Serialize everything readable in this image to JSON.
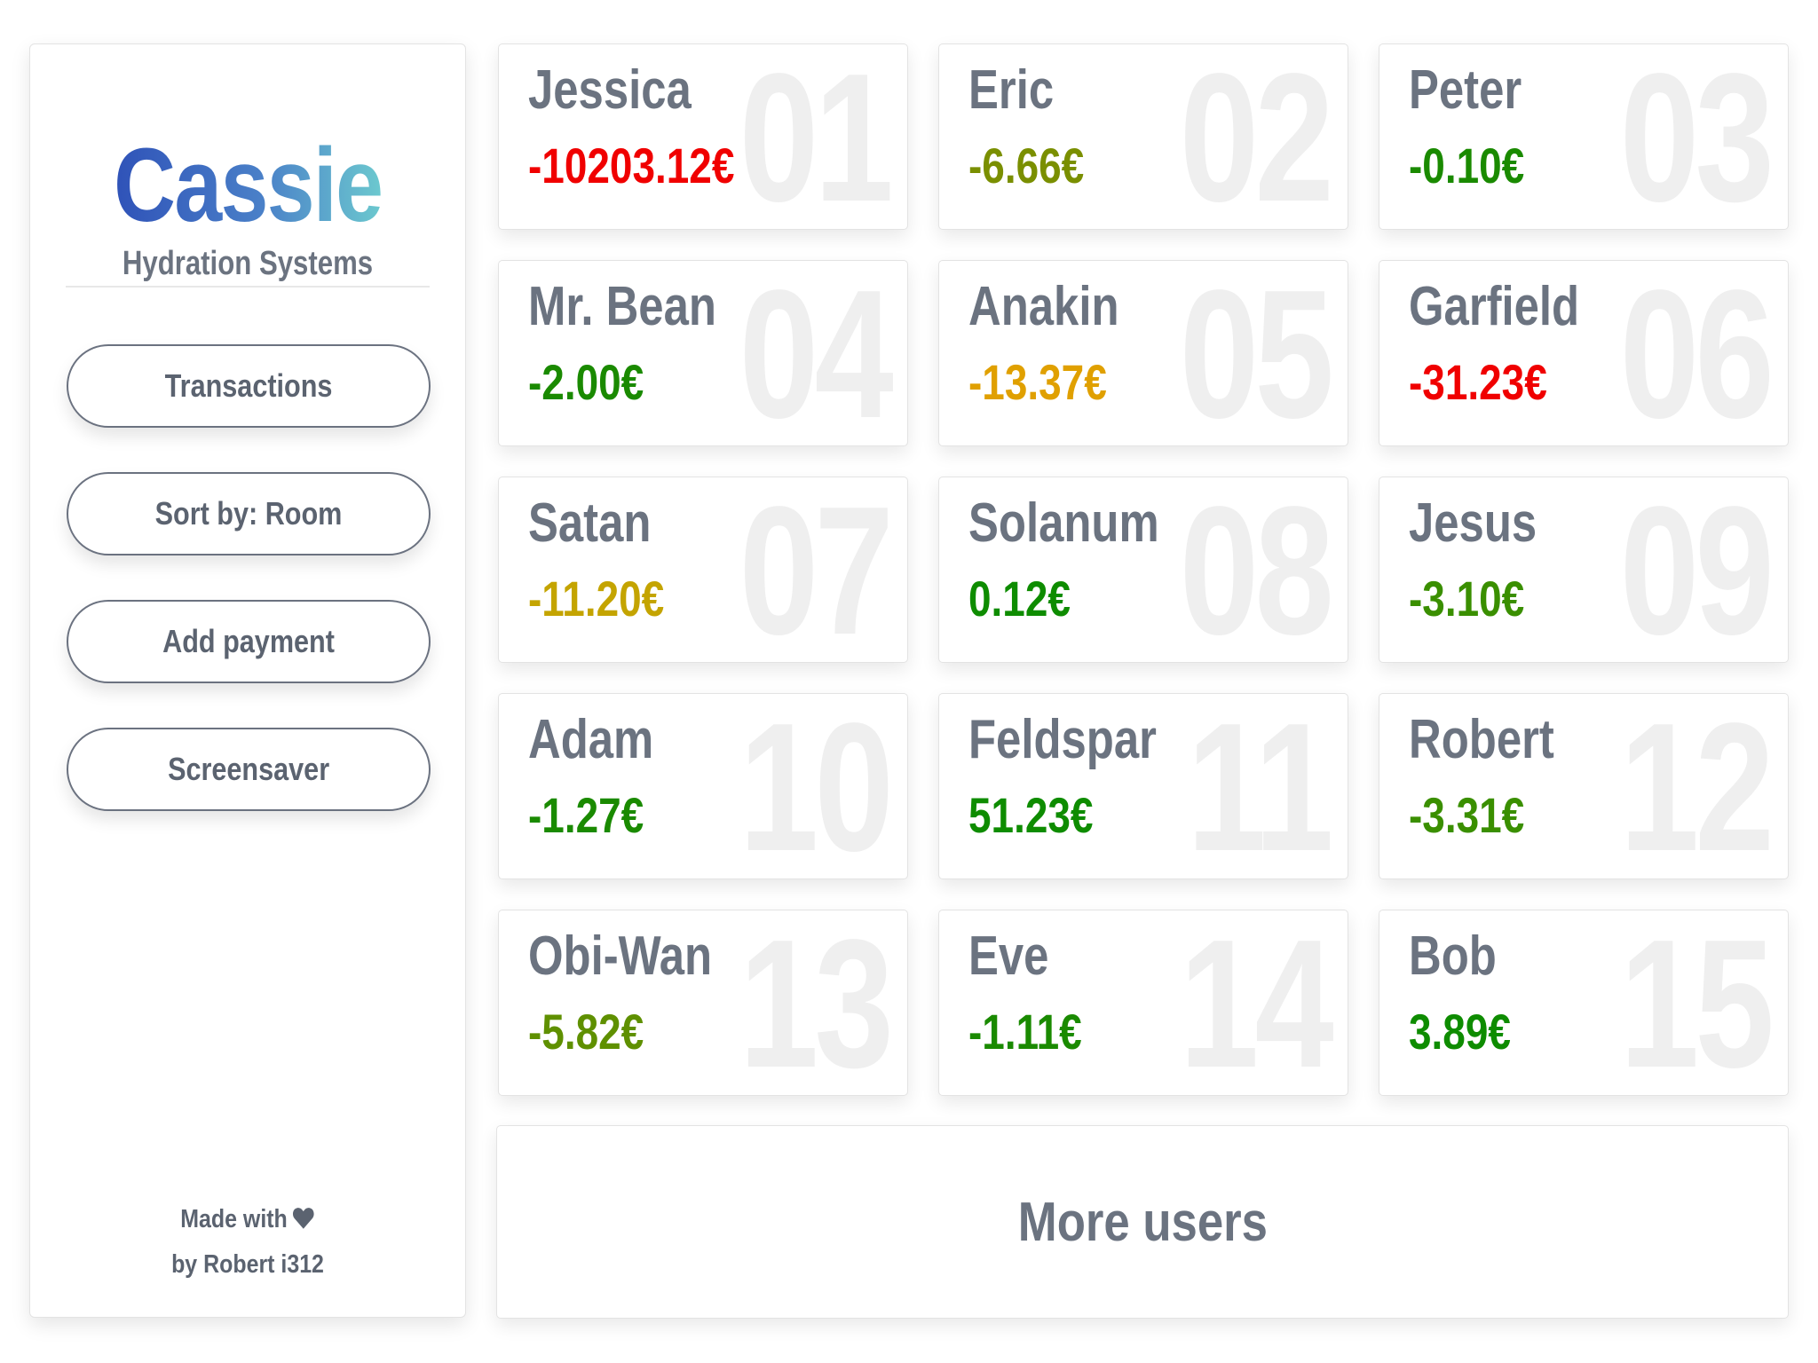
{
  "brand": {
    "title": "Cassie",
    "subtitle": "Hydration Systems"
  },
  "nav": [
    {
      "label": "Transactions"
    },
    {
      "label": "Sort by: Room"
    },
    {
      "label": "Add payment"
    },
    {
      "label": "Screensaver"
    }
  ],
  "footer": {
    "line1": "Made with",
    "line2": "by Robert i312"
  },
  "colors": {
    "negative_large": "#f00000",
    "olive": "#7a8f00",
    "green": "#1a8a00",
    "orange": "#e0a000",
    "mustard": "#c4a400",
    "dark_green": "#0e8c00"
  },
  "users": [
    {
      "number": "01",
      "name": "Jessica",
      "balance": "-10203.12€",
      "color": "#f00000"
    },
    {
      "number": "02",
      "name": "Eric",
      "balance": "-6.66€",
      "color": "#7a8f00"
    },
    {
      "number": "03",
      "name": "Peter",
      "balance": "-0.10€",
      "color": "#1a8a00"
    },
    {
      "number": "04",
      "name": "Mr. Bean",
      "balance": "-2.00€",
      "color": "#1a8a00"
    },
    {
      "number": "05",
      "name": "Anakin",
      "balance": "-13.37€",
      "color": "#e0a000"
    },
    {
      "number": "06",
      "name": "Garfield",
      "balance": "-31.23€",
      "color": "#f00000"
    },
    {
      "number": "07",
      "name": "Satan",
      "balance": "-11.20€",
      "color": "#c4a400"
    },
    {
      "number": "08",
      "name": "Solanum",
      "balance": "0.12€",
      "color": "#0e8c00"
    },
    {
      "number": "09",
      "name": "Jesus",
      "balance": "-3.10€",
      "color": "#3a8f00"
    },
    {
      "number": "10",
      "name": "Adam",
      "balance": "-1.27€",
      "color": "#1a8a00"
    },
    {
      "number": "11",
      "name": "Feldspar",
      "balance": "51.23€",
      "color": "#0e8c00"
    },
    {
      "number": "12",
      "name": "Robert",
      "balance": "-3.31€",
      "color": "#3a8f00"
    },
    {
      "number": "13",
      "name": "Obi-Wan",
      "balance": "-5.82€",
      "color": "#5f9000"
    },
    {
      "number": "14",
      "name": "Eve",
      "balance": "-1.11€",
      "color": "#1a8a00"
    },
    {
      "number": "15",
      "name": "Bob",
      "balance": "3.89€",
      "color": "#0e8c00"
    }
  ],
  "more_users": {
    "label": "More users"
  }
}
